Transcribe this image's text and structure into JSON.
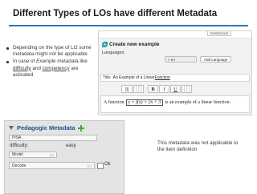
{
  "slide": {
    "title": "Different Types of LOs have different Metadata",
    "bullet1": "Depending on the type of LO some metadata might not be applicable",
    "bullet2_part1": "In case of ",
    "bullet2_example": "Example",
    "bullet2_part2": " metadata like ",
    "bullet2_difficulty": "difficulty",
    "bullet2_part3": " and ",
    "bullet2_competency": "competency",
    "bullet2_part4": " are activated",
    "note": "This metadata was not applicable to the item definition"
  },
  "editor": {
    "dashboard_label": "Dashboard",
    "create_title": "Create new example",
    "languages_label": "Languages:",
    "language_value": "« en",
    "add_language_button": "Add Language",
    "title_label": "Title:",
    "title_value_prefix": "An Example of a Linear ",
    "title_value_function": "Function",
    "toolbar": {
      "pi": "π",
      "bold": "B",
      "italic": "I",
      "underline": "U"
    },
    "content_prefix": "A function",
    "content_formula": "y = f(x) = 2x + 3",
    "content_suffix": "is an example of a linear function."
  },
  "metadata": {
    "title": "Pedagogic Metadata",
    "framework_value": "PISA",
    "difficulty_label": "difficulty:",
    "difficulty_value": "easy",
    "model_value": "Model",
    "decode_value": "Decode",
    "ok_label": "Ok"
  },
  "colors": {
    "title_rule": "#2e75b6",
    "metadata_title": "#1b4f8a",
    "plus_icon": "#4aa53c",
    "logo": "#2aa1a8"
  }
}
